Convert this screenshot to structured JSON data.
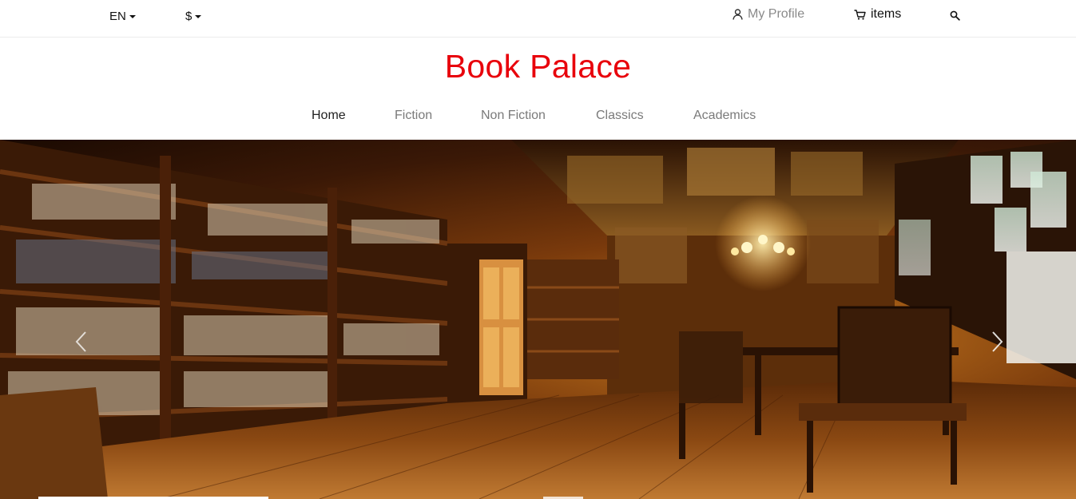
{
  "topbar": {
    "language": "EN",
    "currency": "$",
    "profile_label": "My Profile",
    "cart_label": "items"
  },
  "brand": {
    "name": "Book Palace",
    "color": "#e8000b"
  },
  "nav": {
    "items": [
      {
        "label": "Home",
        "active": true
      },
      {
        "label": "Fiction",
        "active": false
      },
      {
        "label": "Non Fiction",
        "active": false
      },
      {
        "label": "Classics",
        "active": false
      },
      {
        "label": "Academics",
        "active": false
      }
    ]
  },
  "icons": {
    "profile": "user-icon",
    "cart": "cart-icon",
    "search": "search-icon",
    "prev": "chevron-left-icon",
    "next": "chevron-right-icon"
  },
  "hero": {
    "image_subject": "library-interior"
  }
}
